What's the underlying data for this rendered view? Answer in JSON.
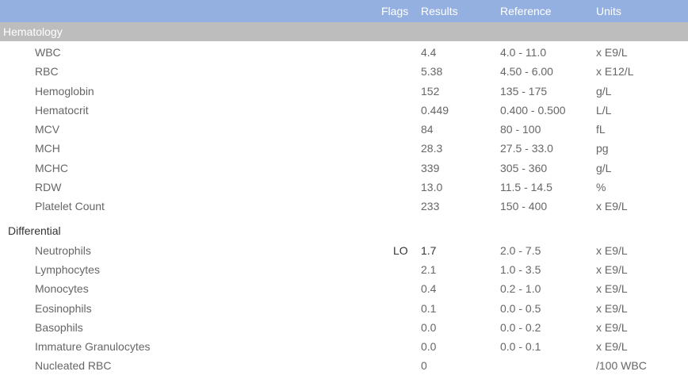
{
  "header": {
    "flags": "Flags",
    "results": "Results",
    "reference": "Reference",
    "units": "Units"
  },
  "section": "Hematology",
  "rows_top": [
    {
      "name": "WBC",
      "flag": "",
      "result": "4.4",
      "reference": "4.0 - 11.0",
      "unit": "x E9/L"
    },
    {
      "name": "RBC",
      "flag": "",
      "result": "5.38",
      "reference": "4.50 - 6.00",
      "unit": "x E12/L"
    },
    {
      "name": "Hemoglobin",
      "flag": "",
      "result": "152",
      "reference": "135 - 175",
      "unit": "g/L"
    },
    {
      "name": "Hematocrit",
      "flag": "",
      "result": "0.449",
      "reference": "0.400 - 0.500",
      "unit": "L/L"
    },
    {
      "name": "MCV",
      "flag": "",
      "result": "84",
      "reference": "80 - 100",
      "unit": "fL"
    },
    {
      "name": "MCH",
      "flag": "",
      "result": "28.3",
      "reference": "27.5 - 33.0",
      "unit": "pg"
    },
    {
      "name": "MCHC",
      "flag": "",
      "result": "339",
      "reference": "305 - 360",
      "unit": "g/L"
    },
    {
      "name": "RDW",
      "flag": "",
      "result": "13.0",
      "reference": "11.5 - 14.5",
      "unit": "%"
    },
    {
      "name": "Platelet Count",
      "flag": "",
      "result": "233",
      "reference": "150 - 400",
      "unit": "x E9/L"
    }
  ],
  "subsection": "Differential",
  "rows_diff": [
    {
      "name": "Neutrophils",
      "flag": "LO",
      "result": "1.7",
      "reference": "2.0 - 7.5",
      "unit": "x E9/L"
    },
    {
      "name": "Lymphocytes",
      "flag": "",
      "result": "2.1",
      "reference": "1.0 - 3.5",
      "unit": "x E9/L"
    },
    {
      "name": "Monocytes",
      "flag": "",
      "result": "0.4",
      "reference": "0.2 - 1.0",
      "unit": "x E9/L"
    },
    {
      "name": "Eosinophils",
      "flag": "",
      "result": "0.1",
      "reference": "0.0 - 0.5",
      "unit": "x E9/L"
    },
    {
      "name": "Basophils",
      "flag": "",
      "result": "0.0",
      "reference": "0.0 - 0.2",
      "unit": "x E9/L"
    },
    {
      "name": "Immature Granulocytes",
      "flag": "",
      "result": "0.0",
      "reference": "0.0 - 0.1",
      "unit": "x E9/L"
    },
    {
      "name": "Nucleated RBC",
      "flag": "",
      "result": "0",
      "reference": "",
      "unit": "/100 WBC"
    }
  ]
}
